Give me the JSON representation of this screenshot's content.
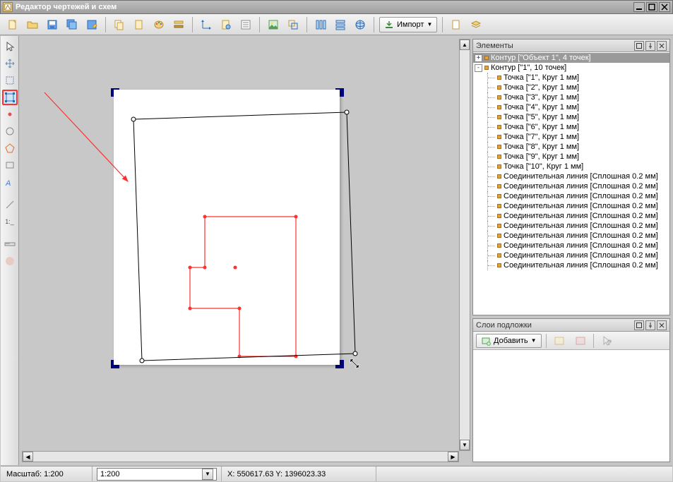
{
  "window": {
    "title": "Редактор чертежей и схем"
  },
  "toolbar": {
    "import_label": "Импорт"
  },
  "panels": {
    "elements": {
      "title": "Элементы",
      "tree": [
        {
          "depth": 0,
          "toggle": "+",
          "label": "Контур [\"Объект 1\", 4 точек]",
          "selected": true
        },
        {
          "depth": 0,
          "toggle": "-",
          "label": "Контур [\"1\", 10 точек]"
        },
        {
          "depth": 1,
          "label": "Точка [\"1\", Круг 1 мм]"
        },
        {
          "depth": 1,
          "label": "Точка [\"2\", Круг 1 мм]"
        },
        {
          "depth": 1,
          "label": "Точка [\"3\", Круг 1 мм]"
        },
        {
          "depth": 1,
          "label": "Точка [\"4\", Круг 1 мм]"
        },
        {
          "depth": 1,
          "label": "Точка [\"5\", Круг 1 мм]"
        },
        {
          "depth": 1,
          "label": "Точка [\"6\", Круг 1 мм]"
        },
        {
          "depth": 1,
          "label": "Точка [\"7\", Круг 1 мм]"
        },
        {
          "depth": 1,
          "label": "Точка [\"8\", Круг 1 мм]"
        },
        {
          "depth": 1,
          "label": "Точка [\"9\", Круг 1 мм]"
        },
        {
          "depth": 1,
          "label": "Точка [\"10\", Круг 1 мм]"
        },
        {
          "depth": 1,
          "label": "Соединительная линия [Сплошная 0.2 мм]"
        },
        {
          "depth": 1,
          "label": "Соединительная линия [Сплошная 0.2 мм]"
        },
        {
          "depth": 1,
          "label": "Соединительная линия [Сплошная 0.2 мм]"
        },
        {
          "depth": 1,
          "label": "Соединительная линия [Сплошная 0.2 мм]"
        },
        {
          "depth": 1,
          "label": "Соединительная линия [Сплошная 0.2 мм]"
        },
        {
          "depth": 1,
          "label": "Соединительная линия [Сплошная 0.2 мм]"
        },
        {
          "depth": 1,
          "label": "Соединительная линия [Сплошная 0.2 мм]"
        },
        {
          "depth": 1,
          "label": "Соединительная линия [Сплошная 0.2 мм]"
        },
        {
          "depth": 1,
          "label": "Соединительная линия [Сплошная 0.2 мм]"
        },
        {
          "depth": 1,
          "label": "Соединительная линия [Сплошная 0.2 мм]"
        }
      ]
    },
    "layers": {
      "title": "Слои подложки",
      "add_label": "Добавить"
    }
  },
  "status": {
    "scale_label": "Масштаб: 1:200",
    "scale_combo": "1:200",
    "coords": "X: 550617.63 Y: 1396023.33"
  },
  "left_tools": {
    "selected_index": 3
  },
  "colors": {
    "handle": "#000080",
    "shape": "#ff3030",
    "arrow": "#ff3030"
  }
}
